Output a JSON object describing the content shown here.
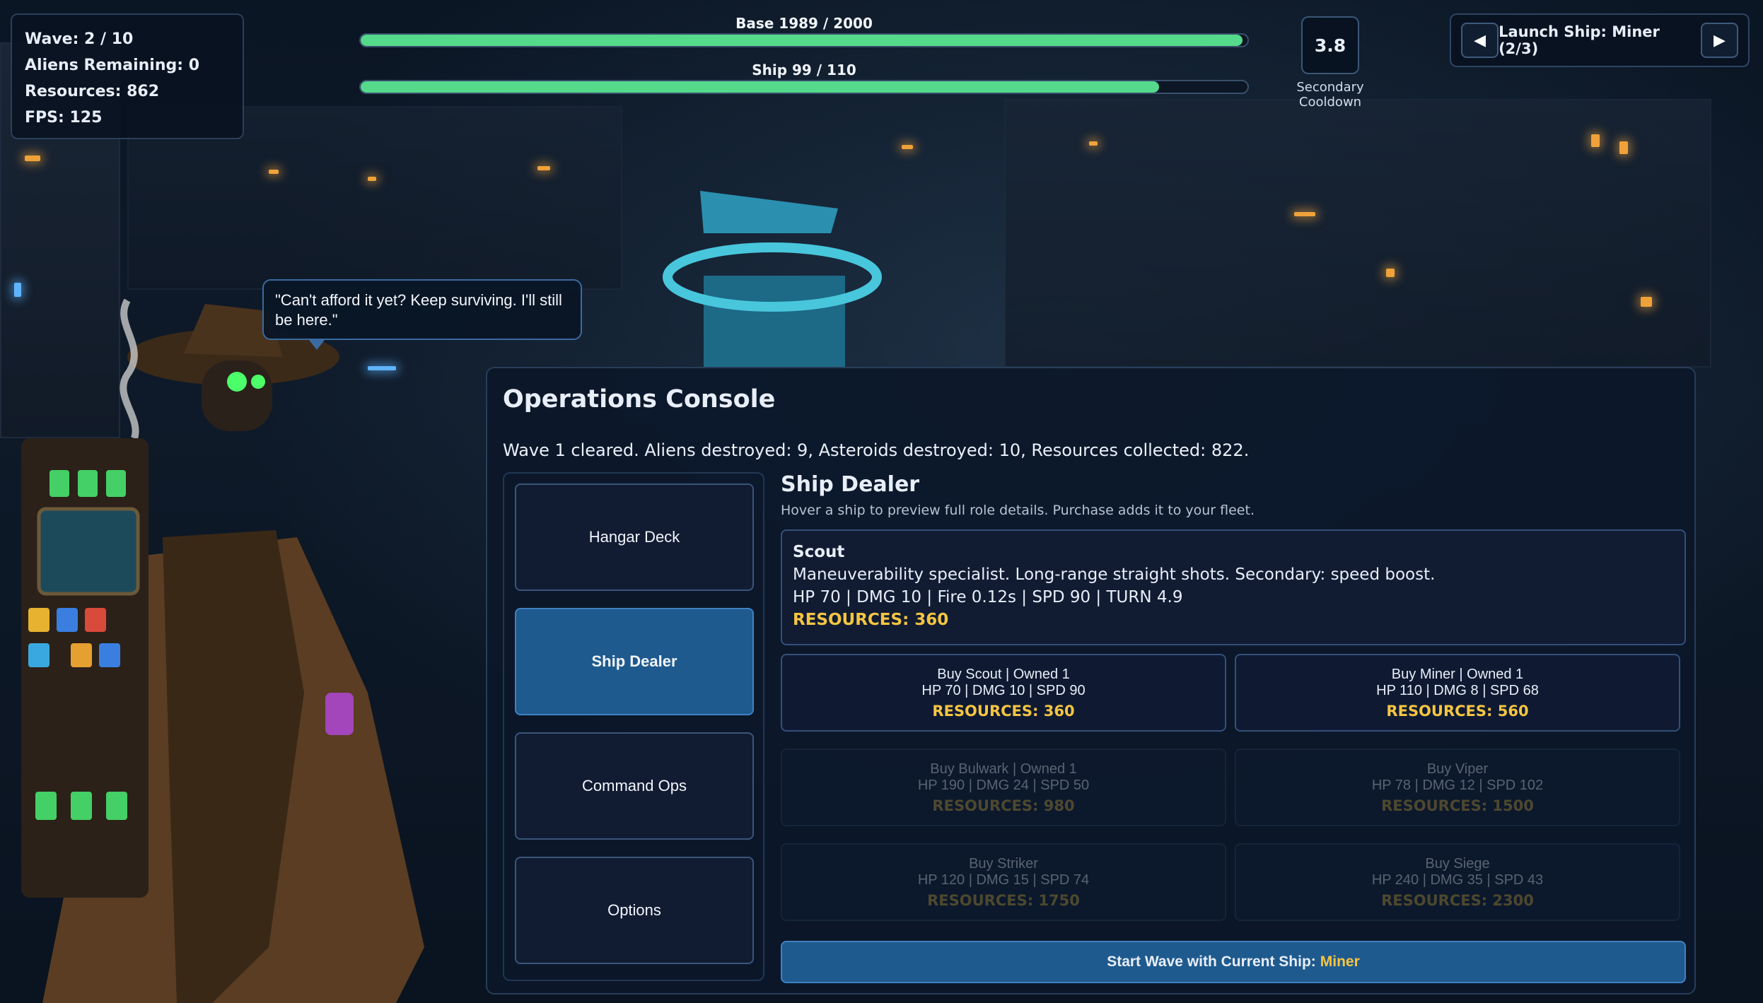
{
  "hud": {
    "wave": "Wave: 2 / 10",
    "aliens_remaining": "Aliens Remaining: 0",
    "resources": "Resources: 862",
    "fps": "FPS: 125"
  },
  "bars": {
    "base": {
      "label": "Base 1989 / 2000",
      "fraction": 0.9945
    },
    "ship": {
      "label": "Ship 99 / 110",
      "fraction": 0.9
    }
  },
  "secondary": {
    "value": "3.8",
    "label": "Secondary Cooldown"
  },
  "launch": {
    "label": "Launch Ship: Miner (2/3)",
    "prev_icon": "◀",
    "next_icon": "▶"
  },
  "merchant": {
    "quote": "\"Can't afford it yet? Keep surviving. I'll still be here.\""
  },
  "console": {
    "title": "Operations Console",
    "message": "Wave 1 cleared. Aliens destroyed: 9, Asteroids destroyed: 10, Resources collected: 822.",
    "nav": [
      {
        "label": "Hangar Deck",
        "active": false
      },
      {
        "label": "Ship Dealer",
        "active": true
      },
      {
        "label": "Command Ops",
        "active": false
      },
      {
        "label": "Options",
        "active": false
      }
    ]
  },
  "dealer": {
    "title": "Ship Dealer",
    "subtitle": "Hover a ship to preview full role details. Purchase adds it to your fleet.",
    "preview": {
      "name": "Scout",
      "description": "Maneuverability specialist. Long-range straight shots. Secondary: speed boost.",
      "stats": "HP 70 | DMG 10 | Fire 0.12s | SPD 90 | TURN 4.9",
      "price": "RESOURCES: 360"
    },
    "ships": [
      {
        "title": "Buy Scout | Owned 1",
        "stats": "HP 70 | DMG 10 | SPD 90",
        "price": "RESOURCES: 360",
        "affordable": true
      },
      {
        "title": "Buy Miner | Owned 1",
        "stats": "HP 110 | DMG 8 | SPD 68",
        "price": "RESOURCES: 560",
        "affordable": true
      },
      {
        "title": "Buy Bulwark | Owned 1",
        "stats": "HP 190 | DMG 24 | SPD 50",
        "price": "RESOURCES: 980",
        "affordable": false
      },
      {
        "title": "Buy Viper",
        "stats": "HP 78 | DMG 12 | SPD 102",
        "price": "RESOURCES: 1500",
        "affordable": false
      },
      {
        "title": "Buy Striker",
        "stats": "HP 120 | DMG 15 | SPD 74",
        "price": "RESOURCES: 1750",
        "affordable": false
      },
      {
        "title": "Buy Siege",
        "stats": "HP 240 | DMG 35 | SPD 43",
        "price": "RESOURCES: 2300",
        "affordable": false
      }
    ],
    "start_label": "Start Wave with Current Ship:",
    "start_ship": "Miner"
  },
  "colors": {
    "accent_gold": "#f5c542",
    "bar_green": "#55d98a",
    "active_blue": "#1f5a8e"
  }
}
